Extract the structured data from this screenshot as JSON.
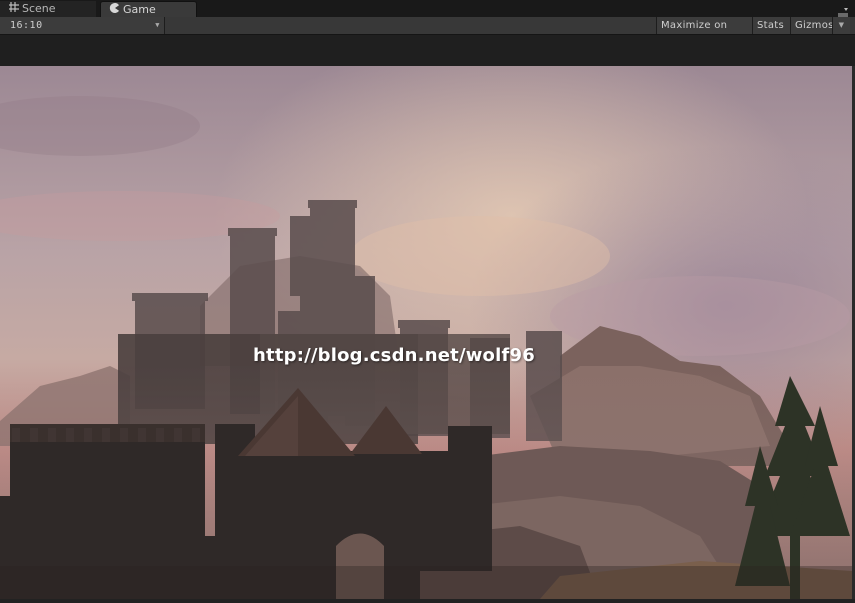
{
  "tabs": {
    "scene_label": "Scene",
    "game_label": "Game",
    "scene_icon": "grid-icon",
    "game_icon": "pacman-icon"
  },
  "toolbar": {
    "aspect_value": "16:10",
    "maximize_label": "Maximize on Play",
    "stats_label": "Stats",
    "gizmos_label": "Gizmos"
  },
  "game_view": {
    "watermark": "http://blog.csdn.net/wolf96",
    "sky_top": "#a58e99",
    "sky_mid": "#c2a9a6",
    "sky_horizon": "#c88984",
    "castle_color": "#3b3433",
    "mountain_color": "#6a5551"
  }
}
